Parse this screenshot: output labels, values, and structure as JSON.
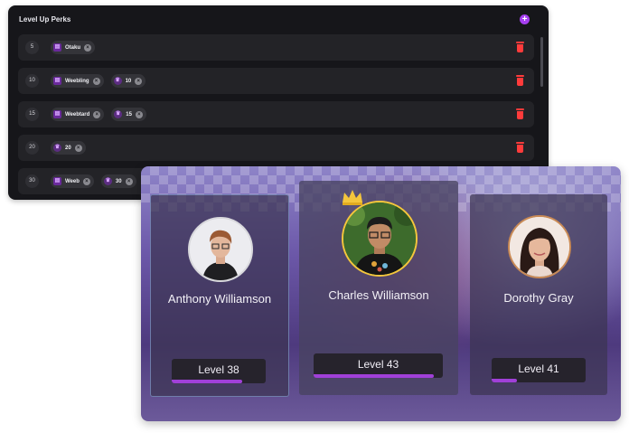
{
  "perks_panel": {
    "title": "Level Up Perks",
    "add_icon": "plus-icon",
    "rows": [
      {
        "level": "5",
        "chips": [
          {
            "icon": "badge-icon",
            "label": "Otaku"
          }
        ]
      },
      {
        "level": "10",
        "chips": [
          {
            "icon": "badge-icon",
            "label": "Weebling"
          },
          {
            "icon": "trophy-icon",
            "label": "10"
          }
        ]
      },
      {
        "level": "15",
        "chips": [
          {
            "icon": "badge-icon",
            "label": "Weebtard"
          },
          {
            "icon": "trophy-icon",
            "label": "15"
          }
        ]
      },
      {
        "level": "20",
        "chips": [
          {
            "icon": "trophy-icon",
            "label": "20"
          }
        ]
      },
      {
        "level": "30",
        "chips": [
          {
            "icon": "badge-icon",
            "label": "Weeb"
          },
          {
            "icon": "trophy-icon",
            "label": "30"
          }
        ]
      }
    ],
    "delete_icon": "trash-icon"
  },
  "leaderboard": {
    "players": [
      {
        "name": "Anthony Williamson",
        "level_label": "Level 38",
        "progress": 0.75
      },
      {
        "name": "Charles Williamson",
        "level_label": "Level 43",
        "progress": 0.93,
        "crown": true
      },
      {
        "name": "Dorothy Gray",
        "level_label": "Level 41",
        "progress": 0.27
      }
    ]
  },
  "colors": {
    "accent": "#a040d8",
    "delete": "#ff3b3b",
    "crown": "#f4c63c"
  }
}
